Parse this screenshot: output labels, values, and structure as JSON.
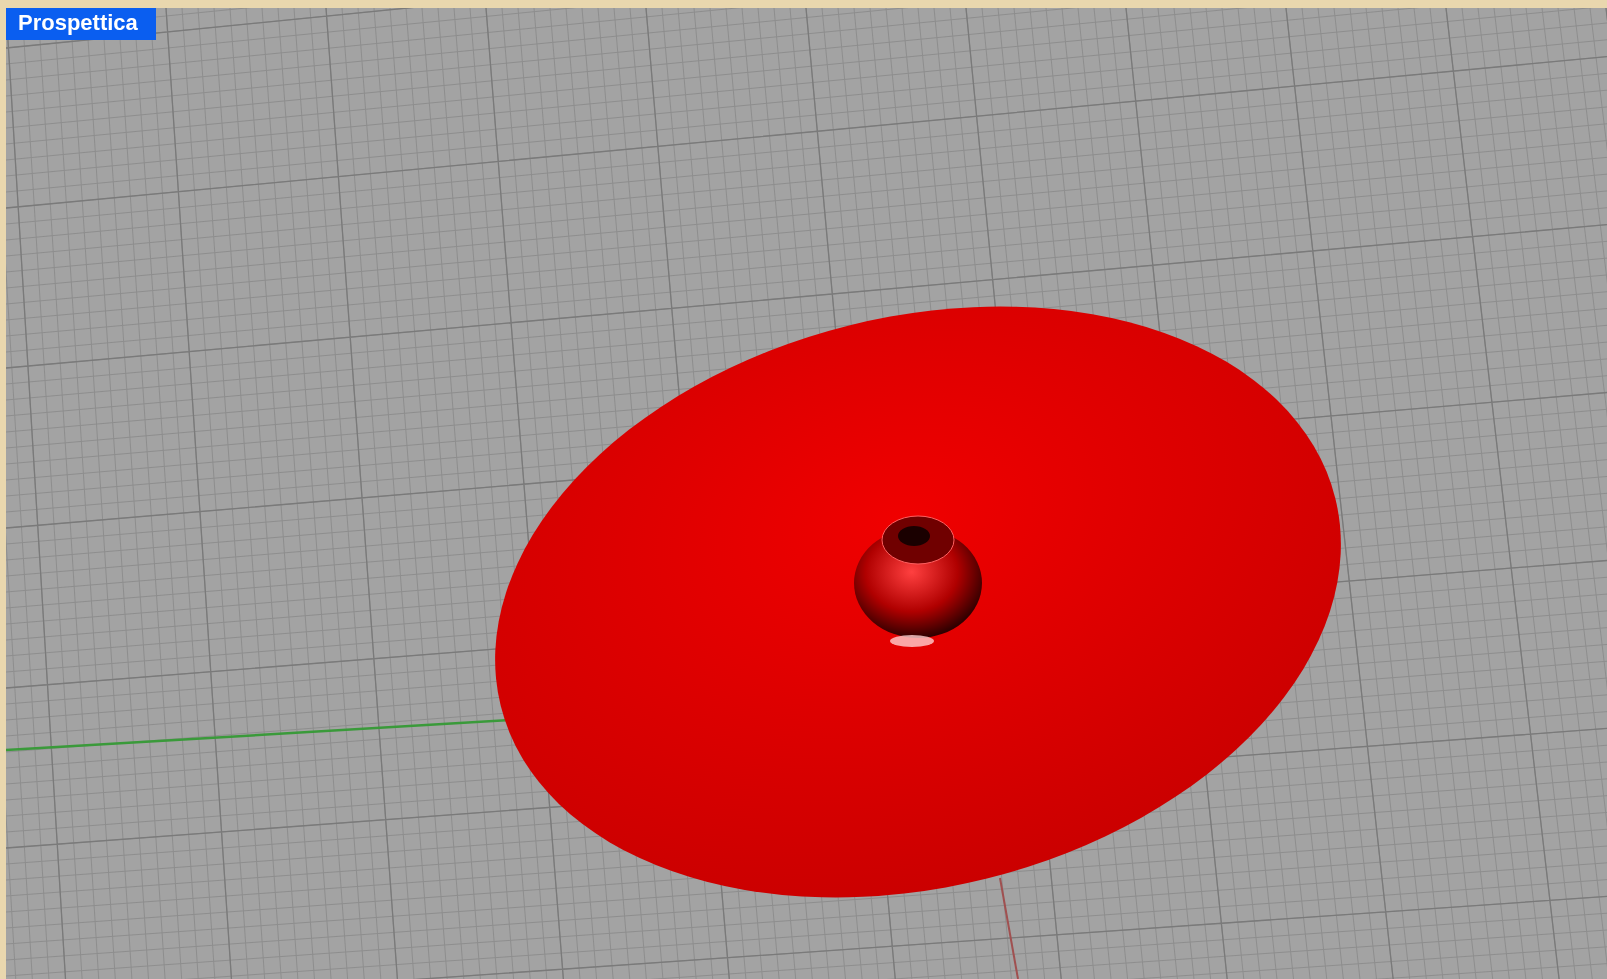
{
  "viewport": {
    "title": "Prospettica"
  }
}
